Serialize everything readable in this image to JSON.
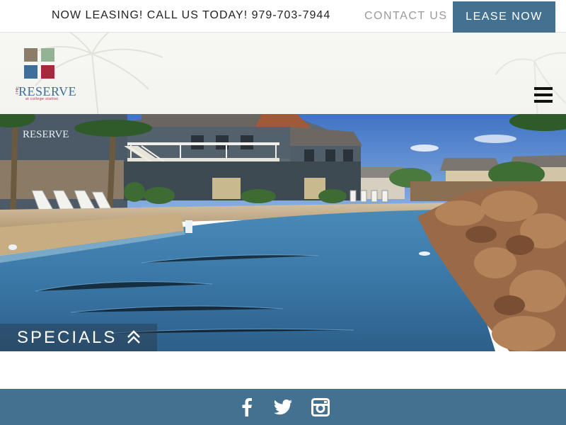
{
  "topbar": {
    "announcement": "NOW LEASING! CALL US TODAY! 979-703-7944",
    "contact_label": "CONTACT US",
    "lease_label": "LEASE NOW"
  },
  "header": {
    "logo": {
      "brand_word": "RESERVE",
      "brand_prefix": "THE",
      "brand_sub": "at college station",
      "colors": [
        "#8b7d6a",
        "#93b394",
        "#3e6e9a",
        "#a6293e"
      ]
    },
    "menu_icon": "hamburger-icon"
  },
  "hero": {
    "specials_label": "SPECIALS",
    "specials_icon": "double-chevron-up-icon",
    "building_sign": "RESERVE"
  },
  "footer": {
    "social": [
      {
        "name": "facebook",
        "icon": "facebook-icon"
      },
      {
        "name": "twitter",
        "icon": "twitter-icon"
      },
      {
        "name": "instagram",
        "icon": "instagram-icon"
      }
    ]
  },
  "colors": {
    "accent": "#43718f",
    "text_dark": "#222222",
    "text_muted": "#9a9a9a"
  }
}
